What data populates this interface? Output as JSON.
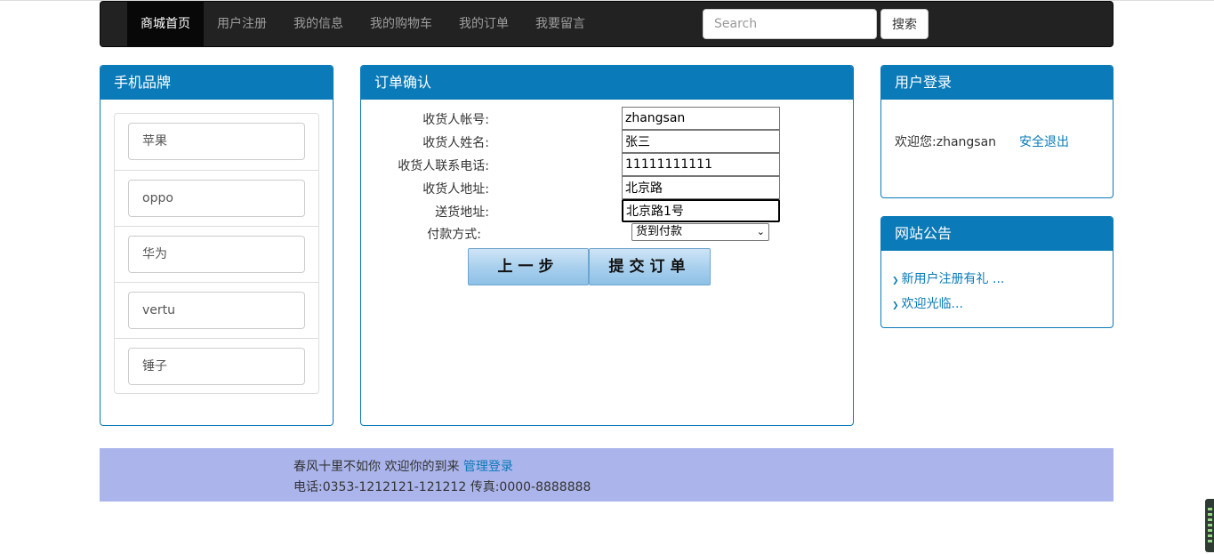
{
  "nav": {
    "items": [
      {
        "label": "商城首页",
        "active": true
      },
      {
        "label": "用户注册",
        "active": false
      },
      {
        "label": "我的信息",
        "active": false
      },
      {
        "label": "我的购物车",
        "active": false
      },
      {
        "label": "我的订单",
        "active": false
      },
      {
        "label": "我要留言",
        "active": false
      }
    ],
    "search_placeholder": "Search",
    "search_button": "搜索"
  },
  "brands": {
    "title": "手机品牌",
    "items": [
      "苹果",
      "oppo",
      "华为",
      "vertu",
      "锤子"
    ]
  },
  "order": {
    "title": "订单确认",
    "fields": [
      {
        "label": "收货人帐号:",
        "value": "zhangsan"
      },
      {
        "label": "收货人姓名:",
        "value": "张三"
      },
      {
        "label": "收货人联系电话:",
        "value": "11111111111"
      },
      {
        "label": "收货人地址:",
        "value": "北京路"
      },
      {
        "label": "送货地址:",
        "value": "北京路1号"
      }
    ],
    "payment_label": "付款方式:",
    "payment_value": "货到付款",
    "prev_button": "上一步",
    "submit_button": "提交订单"
  },
  "login": {
    "title": "用户登录",
    "welcome": "欢迎您:zhangsan",
    "logout": "安全退出"
  },
  "notice": {
    "title": "网站公告",
    "items": [
      "新用户注册有礼 ...",
      "欢迎光临..."
    ]
  },
  "footer": {
    "line1": "春风十里不如你 欢迎你的到来",
    "admin_link": "管理登录",
    "line2": "电话:0353-1212121-121212 传真:0000-8888888"
  },
  "colors": {
    "panel_blue": "#0a7ab8",
    "navbar_bg": "#222222",
    "footer_bg": "#abb5ec"
  }
}
